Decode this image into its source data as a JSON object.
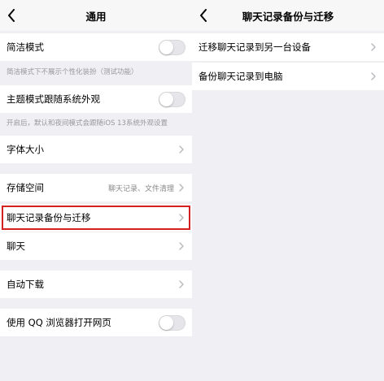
{
  "left": {
    "title": "通用",
    "rows": {
      "simple_mode": {
        "label": "简洁模式",
        "toggle": false
      },
      "simple_mode_hint": "简洁模式下不展示个性化装扮（测试功能）",
      "theme_follow": {
        "label": "主题模式跟随系统外观",
        "toggle": false
      },
      "theme_follow_hint": "开启后，默认和夜间模式会跟随iOS 13系统外观设置",
      "font_size": {
        "label": "字体大小"
      },
      "storage": {
        "label": "存储空间",
        "value": "聊天记录、文件清理"
      },
      "chat_backup": {
        "label": "聊天记录备份与迁移"
      },
      "chat": {
        "label": "聊天"
      },
      "auto_download": {
        "label": "自动下载"
      },
      "qq_browser": {
        "label": "使用 QQ 浏览器打开网页",
        "toggle": false
      }
    }
  },
  "right": {
    "title": "聊天记录备份与迁移",
    "rows": {
      "migrate": {
        "label": "迁移聊天记录到另一台设备"
      },
      "backup_pc": {
        "label": "备份聊天记录到电脑"
      }
    }
  },
  "colors": {
    "background": "#efeff4",
    "highlight": "#d32020",
    "toggle_off": "#e6e6ea"
  },
  "icons": [
    "back-chevron-icon",
    "chevron-right-icon"
  ]
}
